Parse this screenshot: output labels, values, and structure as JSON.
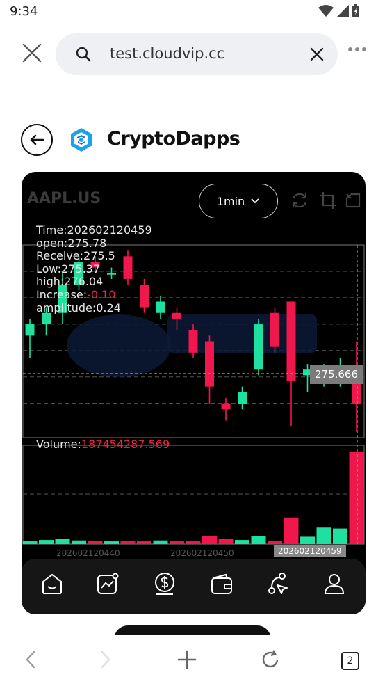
{
  "status": {
    "time": "9:34"
  },
  "browser": {
    "url": "test.cloudvip.cc",
    "tab_count": "2"
  },
  "app": {
    "title": "CryptoDapps"
  },
  "chart": {
    "symbol": "AAPL.US",
    "interval": "1min",
    "info": {
      "time": "Time:202602120459",
      "open": "open:275.78",
      "receive": "Receive:275.5",
      "low": "Low:275.37",
      "high": "high:276.04",
      "increase_label": "Increase:",
      "increase_value": "-0.10",
      "amplitude": "amplitude:0.24"
    },
    "current_price": "275.666",
    "volume_label": "Volume:",
    "volume_value": "187454287.569",
    "time_labels": [
      "202602120440",
      "202602120450",
      "202602120459"
    ]
  },
  "colors": {
    "up": "#1ee0a0",
    "down": "#f0174d",
    "bg": "#000000"
  },
  "nav": [
    "home-icon",
    "markets-icon",
    "finance-icon",
    "wallet-icon",
    "explore-icon",
    "profile-icon"
  ],
  "chart_data": {
    "type": "candlestick",
    "candles": [
      {
        "o": 275.53,
        "c": 275.55,
        "h": 275.56,
        "l": 275.49,
        "dir": "up"
      },
      {
        "o": 275.55,
        "c": 275.57,
        "h": 275.58,
        "l": 275.53,
        "dir": "up"
      },
      {
        "o": 275.57,
        "c": 275.62,
        "h": 275.64,
        "l": 275.55,
        "dir": "up"
      },
      {
        "o": 275.62,
        "c": 275.66,
        "h": 275.67,
        "l": 275.61,
        "dir": "up"
      },
      {
        "o": 275.66,
        "c": 275.65,
        "h": 275.67,
        "l": 275.64,
        "dir": "down"
      },
      {
        "o": 275.64,
        "c": 275.64,
        "h": 275.65,
        "l": 275.63,
        "dir": "up"
      },
      {
        "o": 275.67,
        "c": 275.63,
        "h": 275.68,
        "l": 275.62,
        "dir": "down"
      },
      {
        "o": 275.62,
        "c": 275.58,
        "h": 275.63,
        "l": 275.57,
        "dir": "down"
      },
      {
        "o": 275.57,
        "c": 275.59,
        "h": 275.6,
        "l": 275.56,
        "dir": "up"
      },
      {
        "o": 275.57,
        "c": 275.56,
        "h": 275.58,
        "l": 275.54,
        "dir": "down"
      },
      {
        "o": 275.54,
        "c": 275.5,
        "h": 275.55,
        "l": 275.49,
        "dir": "down"
      },
      {
        "o": 275.52,
        "c": 275.44,
        "h": 275.53,
        "l": 275.41,
        "dir": "down"
      },
      {
        "o": 275.41,
        "c": 275.4,
        "h": 275.42,
        "l": 275.38,
        "dir": "down"
      },
      {
        "o": 275.41,
        "c": 275.43,
        "h": 275.44,
        "l": 275.4,
        "dir": "up"
      },
      {
        "o": 275.47,
        "c": 275.55,
        "h": 275.56,
        "l": 275.46,
        "dir": "up"
      },
      {
        "o": 275.57,
        "c": 275.51,
        "h": 275.58,
        "l": 275.5,
        "dir": "down"
      },
      {
        "o": 275.59,
        "c": 275.45,
        "h": 275.59,
        "l": 275.37,
        "dir": "down"
      },
      {
        "o": 275.46,
        "c": 275.47,
        "h": 275.48,
        "l": 275.43,
        "dir": "up"
      },
      {
        "o": 275.45,
        "c": 275.47,
        "h": 275.48,
        "l": 275.44,
        "dir": "up"
      },
      {
        "o": 275.46,
        "c": 275.47,
        "h": 275.49,
        "l": 275.44,
        "dir": "up"
      },
      {
        "o": 275.45,
        "c": 275.41,
        "h": 275.52,
        "l": 275.36,
        "dir": "down"
      }
    ],
    "volumes": [
      {
        "v": 0.3,
        "dir": "up"
      },
      {
        "v": 0.45,
        "dir": "up"
      },
      {
        "v": 0.55,
        "dir": "up"
      },
      {
        "v": 0.4,
        "dir": "up"
      },
      {
        "v": 0.35,
        "dir": "down"
      },
      {
        "v": 0.3,
        "dir": "up"
      },
      {
        "v": 0.3,
        "dir": "down"
      },
      {
        "v": 0.3,
        "dir": "down"
      },
      {
        "v": 0.4,
        "dir": "up"
      },
      {
        "v": 0.3,
        "dir": "down"
      },
      {
        "v": 0.3,
        "dir": "down"
      },
      {
        "v": 0.9,
        "dir": "down"
      },
      {
        "v": 0.55,
        "dir": "down"
      },
      {
        "v": 0.45,
        "dir": "up"
      },
      {
        "v": 0.9,
        "dir": "up"
      },
      {
        "v": 0.3,
        "dir": "down"
      },
      {
        "v": 2.9,
        "dir": "down"
      },
      {
        "v": 0.8,
        "dir": "up"
      },
      {
        "v": 1.8,
        "dir": "up"
      },
      {
        "v": 1.7,
        "dir": "up"
      },
      {
        "v": 10.0,
        "dir": "down"
      }
    ],
    "ylim": [
      275.35,
      275.69
    ]
  }
}
